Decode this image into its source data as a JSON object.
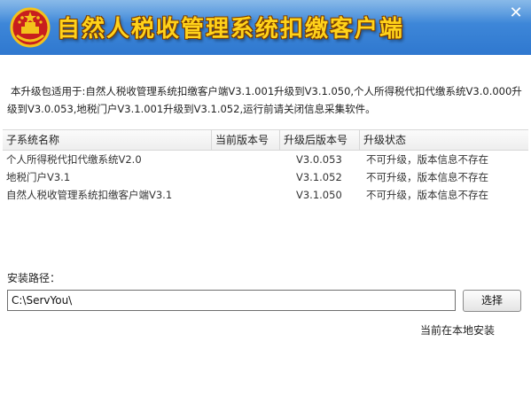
{
  "window": {
    "title": "自然人税收管理系统扣缴客户端",
    "close_glyph": "✕",
    "title_color": "#ffd21a",
    "titlebar_color": "#3d86d8"
  },
  "description": "本升级包适用于:自然人税收管理系统扣缴客户端V3.1.001升级到V3.1.050,个人所得税代扣代缴系统V3.0.000升级到V3.0.053,地税门户V3.1.001升级到V3.1.052,运行前请关闭信息采集软件。",
  "table": {
    "headers": [
      "子系统名称",
      "当前版本号",
      "升级后版本号",
      "升级状态"
    ],
    "rows": [
      {
        "name": "个人所得税代扣代缴系统V2.0",
        "current": "",
        "target": "V3.0.053",
        "status": "不可升级，版本信息不存在"
      },
      {
        "name": "地税门户V3.1",
        "current": "",
        "target": "V3.1.052",
        "status": "不可升级，版本信息不存在"
      },
      {
        "name": "自然人税收管理系统扣缴客户端V3.1",
        "current": "",
        "target": "V3.1.050",
        "status": "不可升级，版本信息不存在"
      }
    ]
  },
  "install": {
    "label": "安装路径：",
    "path_value": "C:\\ServYou\\",
    "choose_label": "选择",
    "status_text": "当前在本地安装"
  }
}
